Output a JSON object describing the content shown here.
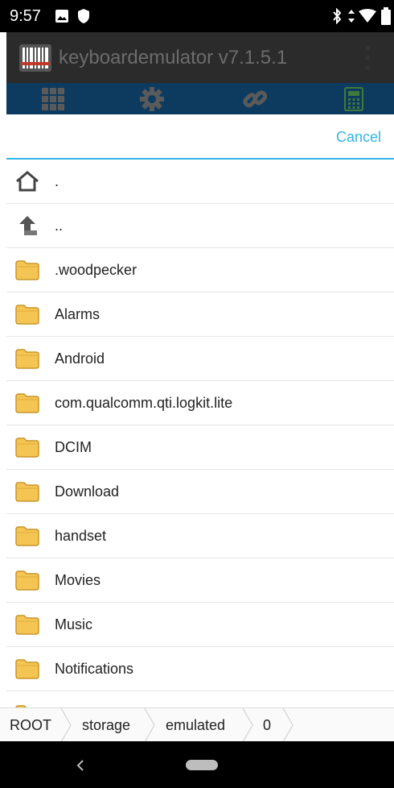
{
  "status_bar": {
    "time": "9:57"
  },
  "app_bar": {
    "title": "keyboardemulator v7.1.5.1"
  },
  "dialog": {
    "cancel_label": "Cancel"
  },
  "file_list": {
    "items": [
      {
        "name": ".",
        "icon": "home-icon"
      },
      {
        "name": "..",
        "icon": "up-arrow-icon"
      },
      {
        "name": ".woodpecker",
        "icon": "folder-icon"
      },
      {
        "name": "Alarms",
        "icon": "folder-icon"
      },
      {
        "name": "Android",
        "icon": "folder-icon"
      },
      {
        "name": "com.qualcomm.qti.logkit.lite",
        "icon": "folder-icon"
      },
      {
        "name": "DCIM",
        "icon": "folder-icon"
      },
      {
        "name": "Download",
        "icon": "folder-icon"
      },
      {
        "name": "handset",
        "icon": "folder-icon"
      },
      {
        "name": "Movies",
        "icon": "folder-icon"
      },
      {
        "name": "Music",
        "icon": "folder-icon"
      },
      {
        "name": "Notifications",
        "icon": "folder-icon"
      }
    ]
  },
  "breadcrumb": {
    "items": [
      "ROOT",
      "storage",
      "emulated",
      "0"
    ]
  },
  "colors": {
    "accent": "#33b5e5",
    "tab_bar": "#0d3b60",
    "folder": "#f5c553"
  }
}
